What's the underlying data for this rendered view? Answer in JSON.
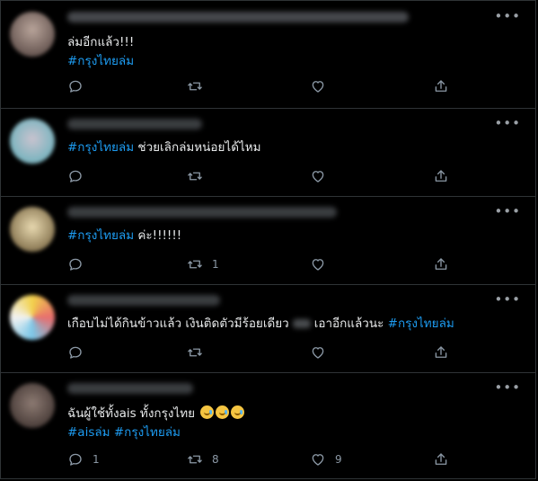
{
  "tweets": [
    {
      "lines": [
        {
          "segments": [
            {
              "text": "ล่มอีกแล้ว!!!",
              "tag": false
            }
          ]
        },
        {
          "segments": [
            {
              "text": "#กรุงไทยล่ม",
              "tag": true
            }
          ]
        }
      ],
      "reply_count": "",
      "retweet_count": "",
      "like_count": ""
    },
    {
      "lines": [
        {
          "segments": [
            {
              "text": "#กรุงไทยล่ม",
              "tag": true
            },
            {
              "text": " ช่วยเลิกล่มหน่อยได้ไหม",
              "tag": false
            }
          ]
        }
      ],
      "reply_count": "",
      "retweet_count": "",
      "like_count": ""
    },
    {
      "lines": [
        {
          "segments": [
            {
              "text": "#กรุงไทยล่ม",
              "tag": true
            },
            {
              "text": " ค่ะ!!!!!!",
              "tag": false
            }
          ]
        }
      ],
      "reply_count": "",
      "retweet_count": "1",
      "like_count": ""
    },
    {
      "lines": [
        {
          "segments": [
            {
              "text": "เกือบไม่ได้กินข้าวแล้ว เงินติดตัวมีร้อยเดียว",
              "tag": false
            },
            {
              "text": "",
              "blur": true
            },
            {
              "text": "เอาอีกแล้วนะ ",
              "tag": false
            },
            {
              "text": "#กรุงไทยล่ม",
              "tag": true
            }
          ]
        }
      ],
      "reply_count": "",
      "retweet_count": "",
      "like_count": ""
    },
    {
      "lines": [
        {
          "segments": [
            {
              "text": "ฉันผู้ใช้ทั้งais ทั้งกรุงไทย ",
              "tag": false
            },
            {
              "emoji": 3
            }
          ]
        },
        {
          "segments": [
            {
              "text": "#aisล่ม",
              "tag": true
            },
            {
              "text": " ",
              "tag": false
            },
            {
              "text": "#กรุงไทยล่ม",
              "tag": true
            }
          ]
        }
      ],
      "reply_count": "1",
      "retweet_count": "8",
      "like_count": "9"
    }
  ],
  "icons": {
    "more": "more-dots-icon",
    "reply": "reply-bubble-icon",
    "retweet": "retweet-icon",
    "like": "heart-icon",
    "share": "share-icon"
  },
  "colors": {
    "background": "#000000",
    "text": "#e7e9ea",
    "hashtag": "#1d9bf0",
    "muted": "#8b98a5",
    "divider": "#2f3336"
  }
}
